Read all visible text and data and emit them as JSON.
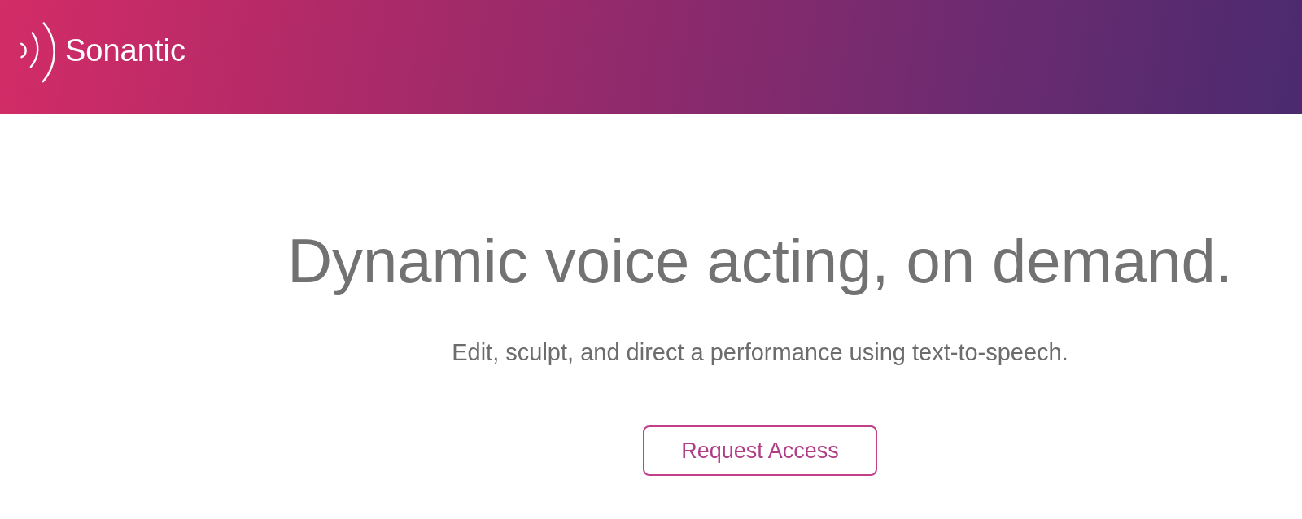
{
  "header": {
    "logo": {
      "name": "Sonantic"
    }
  },
  "hero": {
    "heading": "Dynamic voice acting, on demand.",
    "subheading": "Edit, sculpt, and direct a performance using text-to-speech.",
    "button": {
      "label": "Request Access"
    }
  }
}
